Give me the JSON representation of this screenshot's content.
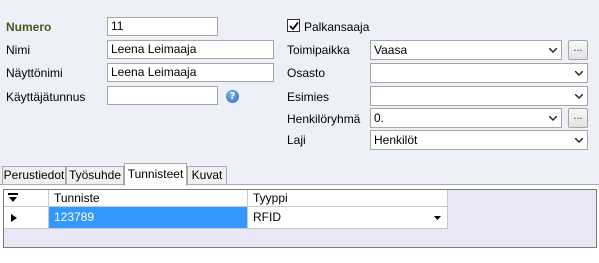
{
  "form": {
    "numero_label": "Numero",
    "numero_value": "11",
    "nimi_label": "Nimi",
    "nimi_value": "Leena Leimaaja",
    "nayttonimi_label": "Näyttönimi",
    "nayttonimi_value": "Leena Leimaaja",
    "kayttajatunnus_label": "Käyttäjätunnus",
    "kayttajatunnus_value": "",
    "help_glyph": "?",
    "palkansaaja_label": "Palkansaaja",
    "palkansaaja_checked": true,
    "toimipaikka_label": "Toimipaikka",
    "toimipaikka_value": "Vaasa",
    "osasto_label": "Osasto",
    "osasto_value": "",
    "esimies_label": "Esimies",
    "esimies_value": "",
    "henkiloryhma_label": "Henkilöryhmä",
    "henkiloryhma_value": "0.",
    "laji_label": "Laji",
    "laji_value": "Henkilöt",
    "browse_label": "..."
  },
  "tabs": [
    {
      "label": "Perustiedot"
    },
    {
      "label": "Työsuhde"
    },
    {
      "label": "Tunnisteet"
    },
    {
      "label": "Kuvat"
    }
  ],
  "active_tab": "Tunnisteet",
  "grid": {
    "columns": [
      "Tunniste",
      "Tyyppi"
    ],
    "rows": [
      {
        "tunniste": "123789",
        "tyyppi": "RFID"
      }
    ]
  },
  "colors": {
    "accent_label": "#4c5a1e",
    "selection": "#3399ff",
    "background": "#eef0f8"
  }
}
